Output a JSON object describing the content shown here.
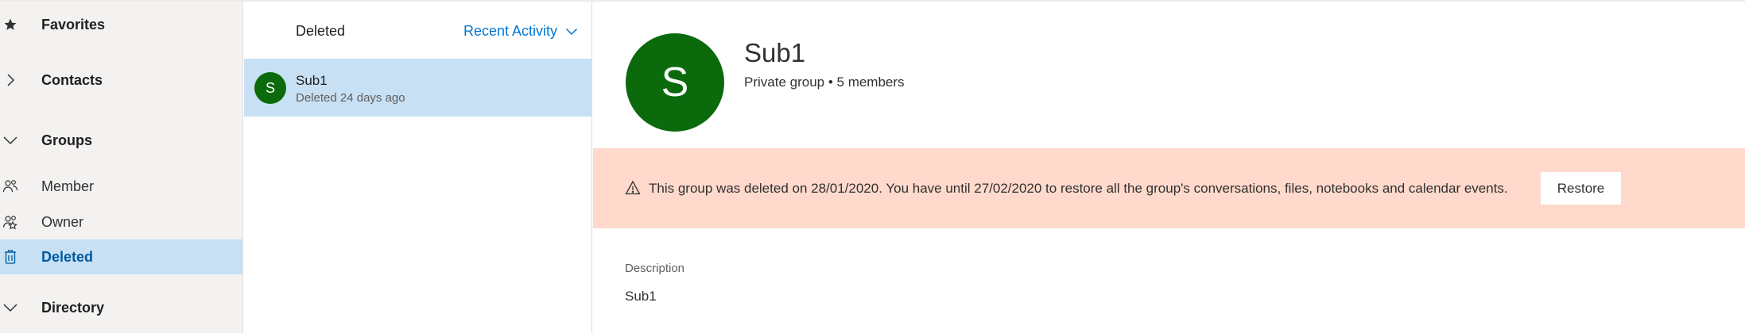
{
  "nav": {
    "items": [
      {
        "label": "Favorites",
        "icon": "star-icon"
      },
      {
        "label": "Contacts",
        "icon": "chevron-right-icon"
      },
      {
        "label": "Groups",
        "icon": "chevron-down-icon"
      },
      {
        "label": "Member",
        "icon": "people-icon"
      },
      {
        "label": "Owner",
        "icon": "people-owner-icon"
      },
      {
        "label": "Deleted",
        "icon": "trash-icon",
        "selected": true
      },
      {
        "label": "Directory",
        "icon": "chevron-down-icon"
      }
    ]
  },
  "list": {
    "title": "Deleted",
    "sort_label": "Recent Activity",
    "rows": [
      {
        "initial": "S",
        "name": "Sub1",
        "subtitle": "Deleted 24 days ago"
      }
    ]
  },
  "detail": {
    "initial": "S",
    "name": "Sub1",
    "meta": "Private group • 5 members",
    "banner_text": "This group was deleted on 28/01/2020. You have until 27/02/2020 to restore all the group's conversations, files, notebooks and calendar events.",
    "restore_label": "Restore",
    "description_label": "Description",
    "description_value": "Sub1"
  },
  "colors": {
    "nav_bg": "#f3f2f1",
    "selected_bg": "#c7e0f4",
    "accent": "#0078d4",
    "avatar_green": "#0b6a0b",
    "banner_bg": "#fed9cc"
  }
}
